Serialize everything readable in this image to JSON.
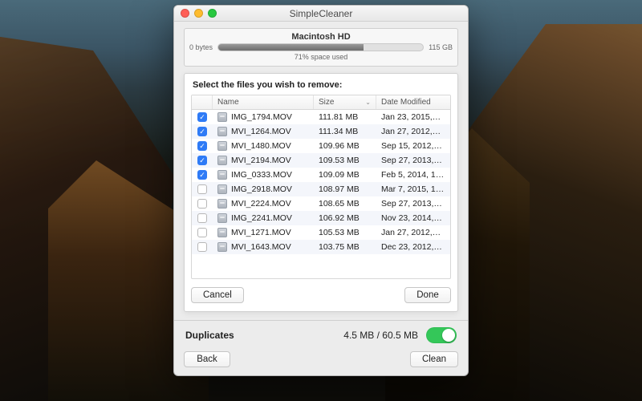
{
  "window": {
    "title": "SimpleCleaner"
  },
  "disk": {
    "name": "Macintosh HD",
    "left_label": "0 bytes",
    "right_label": "115 GB",
    "percent_label": "71% space used",
    "percent_value": 71
  },
  "sheet": {
    "instruction": "Select the files you wish to remove:",
    "columns": {
      "name": "Name",
      "size": "Size",
      "date": "Date Modified"
    },
    "sort_indicator": "size_desc",
    "rows": [
      {
        "checked": true,
        "name": "IMG_1794.MOV",
        "size": "111.81 MB",
        "date": "Jan 23, 2015,…"
      },
      {
        "checked": true,
        "name": "MVI_1264.MOV",
        "size": "111.34 MB",
        "date": "Jan 27, 2012,…"
      },
      {
        "checked": true,
        "name": "MVI_1480.MOV",
        "size": "109.96 MB",
        "date": "Sep 15, 2012,…"
      },
      {
        "checked": true,
        "name": "MVI_2194.MOV",
        "size": "109.53 MB",
        "date": "Sep 27, 2013,…"
      },
      {
        "checked": true,
        "name": "IMG_0333.MOV",
        "size": "109.09 MB",
        "date": "Feb 5, 2014, 1…"
      },
      {
        "checked": false,
        "name": "IMG_2918.MOV",
        "size": "108.97 MB",
        "date": "Mar 7, 2015, 1…"
      },
      {
        "checked": false,
        "name": "MVI_2224.MOV",
        "size": "108.65 MB",
        "date": "Sep 27, 2013,…"
      },
      {
        "checked": false,
        "name": "IMG_2241.MOV",
        "size": "106.92 MB",
        "date": "Nov 23, 2014,…"
      },
      {
        "checked": false,
        "name": "MVI_1271.MOV",
        "size": "105.53 MB",
        "date": "Jan 27, 2012,…"
      },
      {
        "checked": false,
        "name": "MVI_1643.MOV",
        "size": "103.75 MB",
        "date": "Dec 23, 2012,…"
      }
    ],
    "cancel_label": "Cancel",
    "done_label": "Done"
  },
  "footer": {
    "duplicates_label": "Duplicates",
    "duplicates_stats": "4.5 MB / 60.5 MB",
    "toggle_on": true,
    "back_label": "Back",
    "clean_label": "Clean"
  }
}
